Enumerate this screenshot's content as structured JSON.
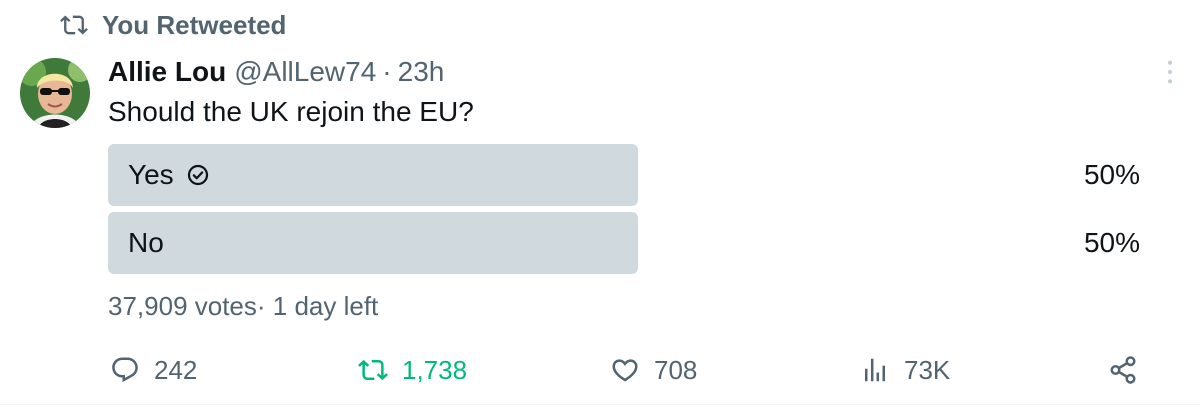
{
  "retweet_header": {
    "label": "You Retweeted",
    "icon": "retweet-icon"
  },
  "author": {
    "name": "Allie Lou",
    "handle": "@AllLew74",
    "separator": "·",
    "time": "23h"
  },
  "tweet": {
    "text": "Should the UK rejoin the EU?"
  },
  "poll": {
    "options": [
      {
        "label": "Yes",
        "percent_label": "50%",
        "share": 0.5,
        "selected": true,
        "icon": "check-circle-icon"
      },
      {
        "label": "No",
        "percent_label": "50%",
        "share": 0.5,
        "selected": false
      }
    ],
    "meta": "37,909 votes· 1 day left"
  },
  "actions": {
    "reply": {
      "count": "242",
      "icon": "reply-icon"
    },
    "retweet": {
      "count": "1,738",
      "icon": "retweet-icon",
      "active": true
    },
    "like": {
      "count": "708",
      "icon": "heart-icon"
    },
    "views": {
      "count": "73K",
      "icon": "analytics-icon"
    },
    "share": {
      "icon": "share-icon"
    }
  },
  "colors": {
    "text_primary": "#0f1419",
    "text_secondary": "#536471",
    "poll_fill": "#cfd9de",
    "retweet_active": "#00ba7c"
  }
}
